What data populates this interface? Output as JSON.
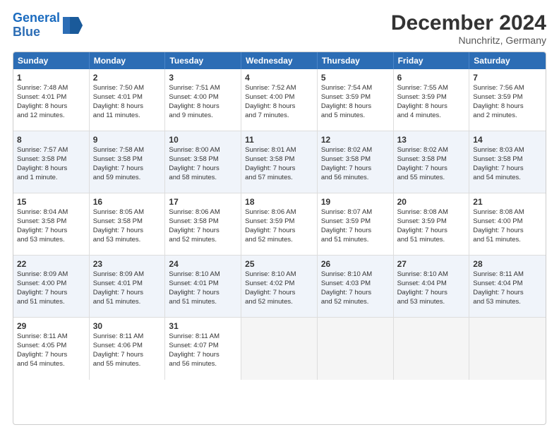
{
  "logo": {
    "line1": "General",
    "line2": "Blue"
  },
  "title": "December 2024",
  "subtitle": "Nunchritz, Germany",
  "header_days": [
    "Sunday",
    "Monday",
    "Tuesday",
    "Wednesday",
    "Thursday",
    "Friday",
    "Saturday"
  ],
  "weeks": [
    [
      {
        "day": "1",
        "lines": [
          "Sunrise: 7:48 AM",
          "Sunset: 4:01 PM",
          "Daylight: 8 hours",
          "and 12 minutes."
        ]
      },
      {
        "day": "2",
        "lines": [
          "Sunrise: 7:50 AM",
          "Sunset: 4:01 PM",
          "Daylight: 8 hours",
          "and 11 minutes."
        ]
      },
      {
        "day": "3",
        "lines": [
          "Sunrise: 7:51 AM",
          "Sunset: 4:00 PM",
          "Daylight: 8 hours",
          "and 9 minutes."
        ]
      },
      {
        "day": "4",
        "lines": [
          "Sunrise: 7:52 AM",
          "Sunset: 4:00 PM",
          "Daylight: 8 hours",
          "and 7 minutes."
        ]
      },
      {
        "day": "5",
        "lines": [
          "Sunrise: 7:54 AM",
          "Sunset: 3:59 PM",
          "Daylight: 8 hours",
          "and 5 minutes."
        ]
      },
      {
        "day": "6",
        "lines": [
          "Sunrise: 7:55 AM",
          "Sunset: 3:59 PM",
          "Daylight: 8 hours",
          "and 4 minutes."
        ]
      },
      {
        "day": "7",
        "lines": [
          "Sunrise: 7:56 AM",
          "Sunset: 3:59 PM",
          "Daylight: 8 hours",
          "and 2 minutes."
        ]
      }
    ],
    [
      {
        "day": "8",
        "lines": [
          "Sunrise: 7:57 AM",
          "Sunset: 3:58 PM",
          "Daylight: 8 hours",
          "and 1 minute."
        ]
      },
      {
        "day": "9",
        "lines": [
          "Sunrise: 7:58 AM",
          "Sunset: 3:58 PM",
          "Daylight: 7 hours",
          "and 59 minutes."
        ]
      },
      {
        "day": "10",
        "lines": [
          "Sunrise: 8:00 AM",
          "Sunset: 3:58 PM",
          "Daylight: 7 hours",
          "and 58 minutes."
        ]
      },
      {
        "day": "11",
        "lines": [
          "Sunrise: 8:01 AM",
          "Sunset: 3:58 PM",
          "Daylight: 7 hours",
          "and 57 minutes."
        ]
      },
      {
        "day": "12",
        "lines": [
          "Sunrise: 8:02 AM",
          "Sunset: 3:58 PM",
          "Daylight: 7 hours",
          "and 56 minutes."
        ]
      },
      {
        "day": "13",
        "lines": [
          "Sunrise: 8:02 AM",
          "Sunset: 3:58 PM",
          "Daylight: 7 hours",
          "and 55 minutes."
        ]
      },
      {
        "day": "14",
        "lines": [
          "Sunrise: 8:03 AM",
          "Sunset: 3:58 PM",
          "Daylight: 7 hours",
          "and 54 minutes."
        ]
      }
    ],
    [
      {
        "day": "15",
        "lines": [
          "Sunrise: 8:04 AM",
          "Sunset: 3:58 PM",
          "Daylight: 7 hours",
          "and 53 minutes."
        ]
      },
      {
        "day": "16",
        "lines": [
          "Sunrise: 8:05 AM",
          "Sunset: 3:58 PM",
          "Daylight: 7 hours",
          "and 53 minutes."
        ]
      },
      {
        "day": "17",
        "lines": [
          "Sunrise: 8:06 AM",
          "Sunset: 3:58 PM",
          "Daylight: 7 hours",
          "and 52 minutes."
        ]
      },
      {
        "day": "18",
        "lines": [
          "Sunrise: 8:06 AM",
          "Sunset: 3:59 PM",
          "Daylight: 7 hours",
          "and 52 minutes."
        ]
      },
      {
        "day": "19",
        "lines": [
          "Sunrise: 8:07 AM",
          "Sunset: 3:59 PM",
          "Daylight: 7 hours",
          "and 51 minutes."
        ]
      },
      {
        "day": "20",
        "lines": [
          "Sunrise: 8:08 AM",
          "Sunset: 3:59 PM",
          "Daylight: 7 hours",
          "and 51 minutes."
        ]
      },
      {
        "day": "21",
        "lines": [
          "Sunrise: 8:08 AM",
          "Sunset: 4:00 PM",
          "Daylight: 7 hours",
          "and 51 minutes."
        ]
      }
    ],
    [
      {
        "day": "22",
        "lines": [
          "Sunrise: 8:09 AM",
          "Sunset: 4:00 PM",
          "Daylight: 7 hours",
          "and 51 minutes."
        ]
      },
      {
        "day": "23",
        "lines": [
          "Sunrise: 8:09 AM",
          "Sunset: 4:01 PM",
          "Daylight: 7 hours",
          "and 51 minutes."
        ]
      },
      {
        "day": "24",
        "lines": [
          "Sunrise: 8:10 AM",
          "Sunset: 4:01 PM",
          "Daylight: 7 hours",
          "and 51 minutes."
        ]
      },
      {
        "day": "25",
        "lines": [
          "Sunrise: 8:10 AM",
          "Sunset: 4:02 PM",
          "Daylight: 7 hours",
          "and 52 minutes."
        ]
      },
      {
        "day": "26",
        "lines": [
          "Sunrise: 8:10 AM",
          "Sunset: 4:03 PM",
          "Daylight: 7 hours",
          "and 52 minutes."
        ]
      },
      {
        "day": "27",
        "lines": [
          "Sunrise: 8:10 AM",
          "Sunset: 4:04 PM",
          "Daylight: 7 hours",
          "and 53 minutes."
        ]
      },
      {
        "day": "28",
        "lines": [
          "Sunrise: 8:11 AM",
          "Sunset: 4:04 PM",
          "Daylight: 7 hours",
          "and 53 minutes."
        ]
      }
    ],
    [
      {
        "day": "29",
        "lines": [
          "Sunrise: 8:11 AM",
          "Sunset: 4:05 PM",
          "Daylight: 7 hours",
          "and 54 minutes."
        ]
      },
      {
        "day": "30",
        "lines": [
          "Sunrise: 8:11 AM",
          "Sunset: 4:06 PM",
          "Daylight: 7 hours",
          "and 55 minutes."
        ]
      },
      {
        "day": "31",
        "lines": [
          "Sunrise: 8:11 AM",
          "Sunset: 4:07 PM",
          "Daylight: 7 hours",
          "and 56 minutes."
        ]
      },
      {
        "day": "",
        "lines": []
      },
      {
        "day": "",
        "lines": []
      },
      {
        "day": "",
        "lines": []
      },
      {
        "day": "",
        "lines": []
      }
    ]
  ]
}
